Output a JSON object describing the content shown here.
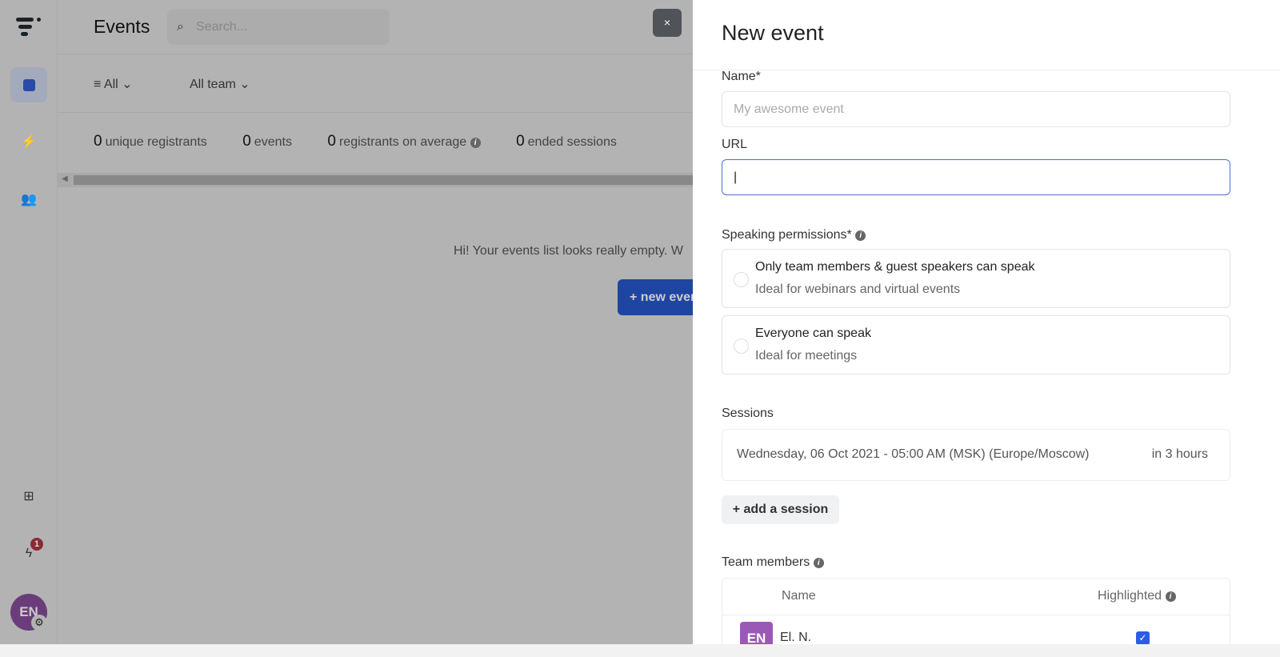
{
  "header": {
    "title": "Events",
    "search_placeholder": "Search..."
  },
  "filters": {
    "type": "All",
    "team": "All team"
  },
  "stats": [
    {
      "value": "0",
      "label": "unique registrants"
    },
    {
      "value": "0",
      "label": "events"
    },
    {
      "value": "0",
      "label": "registrants on average"
    },
    {
      "value": "0",
      "label": "ended sessions"
    }
  ],
  "empty": {
    "message": "Hi! Your events list looks really empty. W",
    "button": "+ new event"
  },
  "sidebar": {
    "notification_count": "1",
    "avatar_initials": "EN"
  },
  "close_label": "×",
  "panel": {
    "title": "New event",
    "name_label": "Name*",
    "name_placeholder": "My awesome event",
    "url_label": "URL",
    "url_value": "|",
    "speaking_label": "Speaking permissions*",
    "options": [
      {
        "title": "Only team members & guest speakers can speak",
        "desc": "Ideal for webinars and virtual events"
      },
      {
        "title": "Everyone can speak",
        "desc": "Ideal for meetings"
      }
    ],
    "sessions_label": "Sessions",
    "session": {
      "date": "Wednesday, 06 Oct 2021 - 05:00 AM (MSK) (Europe/Moscow)",
      "relative": "in 3 hours"
    },
    "add_session": "+ add a session",
    "team_label": "Team members",
    "team_headers": {
      "name": "Name",
      "highlighted": "Highlighted"
    },
    "members": [
      {
        "initials": "EN",
        "name": "El. N.",
        "highlighted": true
      }
    ]
  },
  "colors": {
    "accent": "#2b5ce6",
    "avatar": "#9b59b6"
  }
}
